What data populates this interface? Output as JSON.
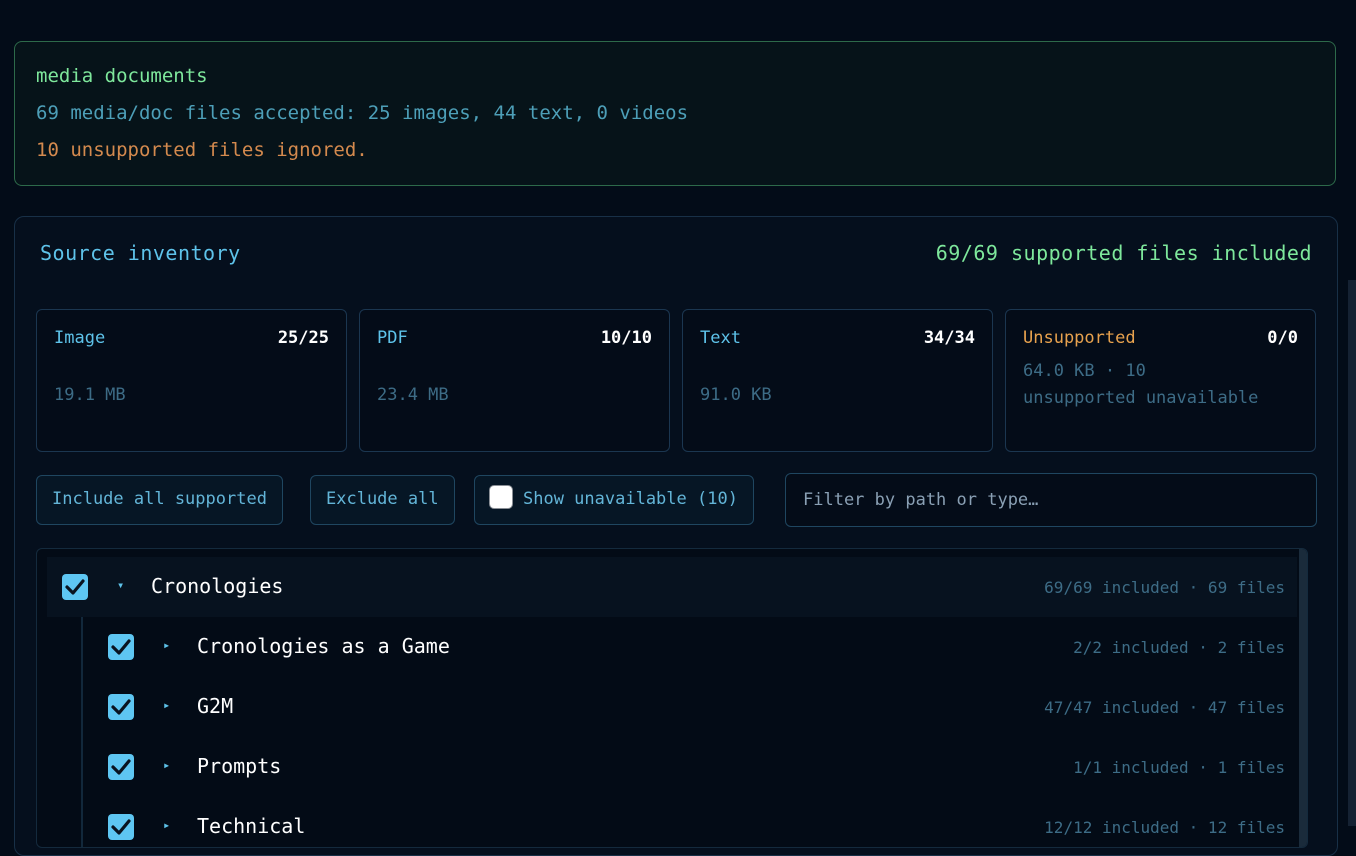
{
  "status": {
    "title": "media documents",
    "accepted": "69 media/doc files accepted: 25 images, 44 text, 0 videos",
    "ignored": "10 unsupported files ignored."
  },
  "inventory": {
    "title": "Source inventory",
    "summary": "69/69 supported files included",
    "cards": [
      {
        "label": "Image",
        "count": "25/25",
        "size": "19.1 MB"
      },
      {
        "label": "PDF",
        "count": "10/10",
        "size": "23.4 MB"
      },
      {
        "label": "Text",
        "count": "34/34",
        "size": "91.0 KB"
      },
      {
        "label": "Unsupported",
        "count": "0/0",
        "meta": "64.0 KB · 10 unsupported unavailable"
      }
    ],
    "buttons": {
      "include_all": "Include all supported",
      "exclude_all": "Exclude all",
      "show_unavailable": "Show unavailable (10)"
    },
    "filter": {
      "placeholder": "Filter by path or type…",
      "value": ""
    },
    "tree": [
      {
        "name": "Cronologies",
        "meta": "69/69 included · 69 files",
        "toggle": "▾",
        "checked": true
      },
      {
        "name": "Cronologies as a Game",
        "meta": "2/2 included · 2 files",
        "toggle": "▸",
        "checked": true
      },
      {
        "name": "G2M",
        "meta": "47/47 included · 47 files",
        "toggle": "▸",
        "checked": true
      },
      {
        "name": "Prompts",
        "meta": "1/1 included · 1 files",
        "toggle": "▸",
        "checked": true
      },
      {
        "name": "Technical",
        "meta": "12/12 included · 12 files",
        "toggle": "▸",
        "checked": true
      }
    ]
  },
  "colors": {
    "accent": "#5ec6f2",
    "success": "#7ee89c",
    "warning": "#d48a4e"
  }
}
